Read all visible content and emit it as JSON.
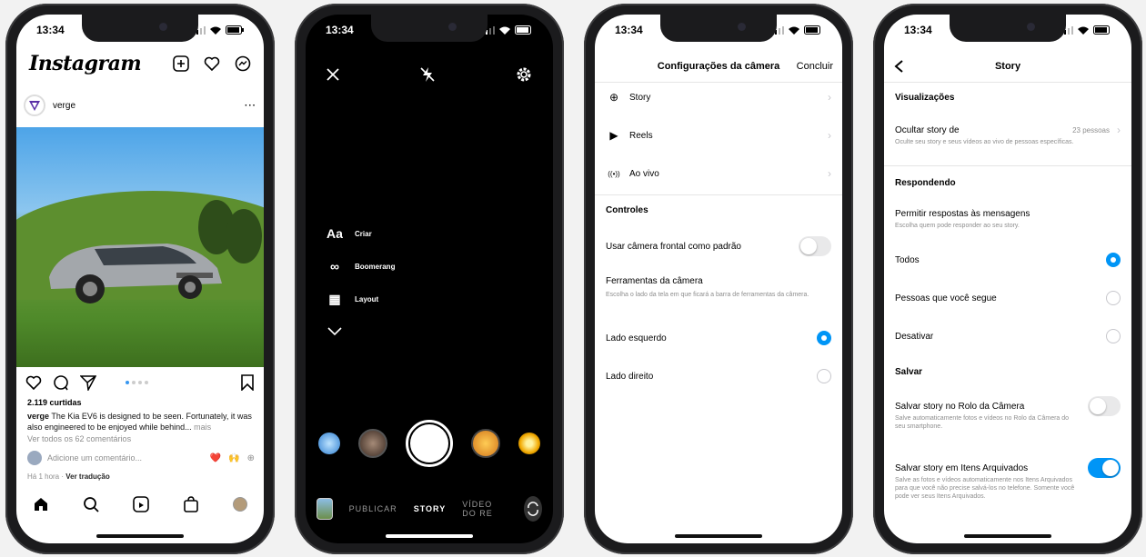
{
  "time": "13:34",
  "phone1": {
    "logo": "Instagram",
    "post_user": "verge",
    "likes": "2.119 curtidas",
    "caption_user": "verge",
    "caption_text": "The Kia EV6 is designed to be seen. Fortunately, it was also engineered to be enjoyed while behind...",
    "caption_more": "mais",
    "comments_link": "Ver todos os 62 comentários",
    "add_comment_placeholder": "Adicione um comentário...",
    "emojis": [
      "❤️",
      "🙌",
      "⊕"
    ],
    "time_ago": "Há 1 hora",
    "translate": "Ver tradução",
    "carousel_dots": 4
  },
  "phone2": {
    "modes": [
      {
        "icon": "Aa",
        "label": "Criar"
      },
      {
        "icon": "∞",
        "label": "Boomerang"
      },
      {
        "icon": "▦",
        "label": "Layout"
      }
    ],
    "tabs": [
      "PUBLICAR",
      "STORY",
      "VÍDEO DO RE"
    ],
    "selected_tab": "STORY"
  },
  "phone3": {
    "title": "Configurações da câmera",
    "done": "Concluir",
    "rows": [
      {
        "icon": "⊕",
        "label": "Story"
      },
      {
        "icon": "▶",
        "label": "Reels"
      },
      {
        "icon": "((•))",
        "label": "Ao vivo"
      }
    ],
    "section_controls": "Controles",
    "front_camera": "Usar câmera frontal como padrão",
    "front_camera_on": false,
    "tools_title": "Ferramentas da câmera",
    "tools_sub": "Escolha o lado da tela em que ficará a barra de ferramentas da câmera.",
    "left_side": "Lado esquerdo",
    "right_side": "Lado direito",
    "selected_side": "Lado esquerdo"
  },
  "phone4": {
    "title": "Story",
    "section_views": "Visualizações",
    "hide_from": "Ocultar story de",
    "hide_from_count": "23 pessoas",
    "hide_from_sub": "Oculte seu story e seus vídeos ao vivo de pessoas específicas.",
    "section_replies": "Respondendo",
    "allow_replies": "Permitir respostas às mensagens",
    "allow_replies_sub": "Escolha quem pode responder ao seu story.",
    "options": [
      "Todos",
      "Pessoas que você segue",
      "Desativar"
    ],
    "selected_option": "Todos",
    "section_save": "Salvar",
    "save_roll": "Salvar story no Rolo da Câmera",
    "save_roll_sub": "Salve automaticamente fotos e vídeos no Rolo da Câmera do seu smartphone.",
    "save_roll_on": false,
    "save_archive": "Salvar story em Itens Arquivados",
    "save_archive_sub": "Salve as fotos e vídeos automaticamente nos Itens Arquivados para que você não precise salvá-los no telefone. Somente você pode ver seus Itens Arquivados.",
    "save_archive_on": true
  },
  "colors": {
    "accent": "#0095f6",
    "heart": "#ed4956"
  }
}
